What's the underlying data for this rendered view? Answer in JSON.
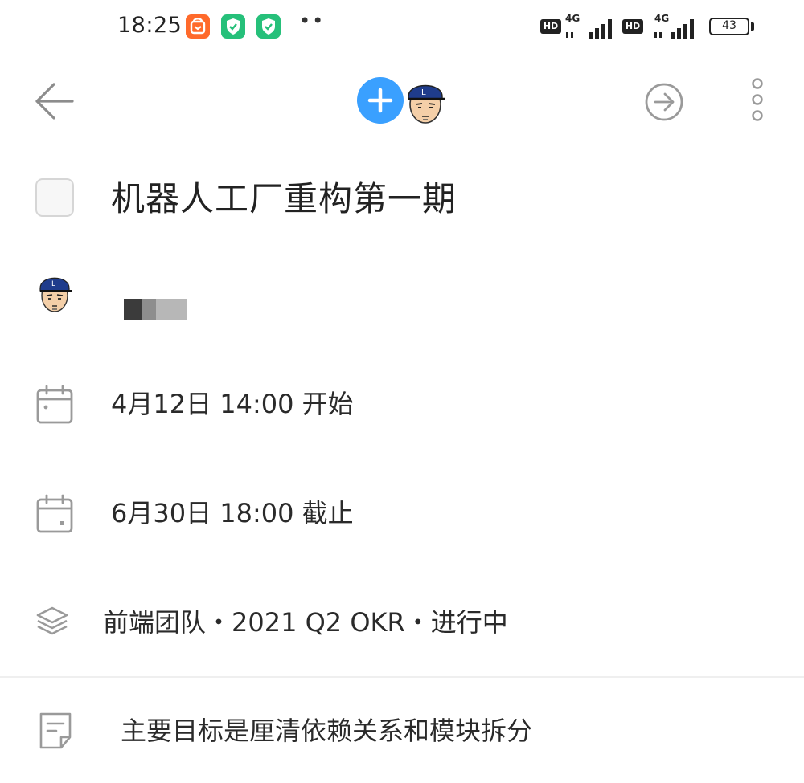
{
  "status_bar": {
    "time": "18:25",
    "more_indicator": "••",
    "sim1": {
      "badge": "HD",
      "network": "4G"
    },
    "sim2": {
      "badge": "HD",
      "network": "4G"
    },
    "battery": "43",
    "app_icons": [
      "taobao-icon",
      "shield-icon",
      "shield-icon"
    ]
  },
  "nav": {
    "back_icon": "arrow-left-icon",
    "add_member_icon": "plus-icon",
    "member_avatar_icon": "avatar-icon",
    "share_icon": "arrow-right-circle-icon",
    "more_icon": "more-vertical-icon"
  },
  "task": {
    "title": "机器人工厂重构第一期",
    "completed": false
  },
  "assignee": {
    "avatar_icon": "avatar-icon",
    "name_redacted": true
  },
  "schedule": {
    "start": "4月12日 14:00 开始",
    "due": "6月30日 18:00 截止",
    "start_icon": "calendar-start-icon",
    "due_icon": "calendar-due-icon"
  },
  "project": {
    "icon": "layers-icon",
    "text": "前端团队・2021 Q2 OKR・进行中"
  },
  "note": {
    "icon": "note-icon",
    "text": "主要目标是厘清依赖关系和模块拆分"
  },
  "colors": {
    "accent": "#3aa0ff",
    "icon_gray": "#9a9a9a",
    "text": "#2a2a2a",
    "divider": "#efefef"
  }
}
